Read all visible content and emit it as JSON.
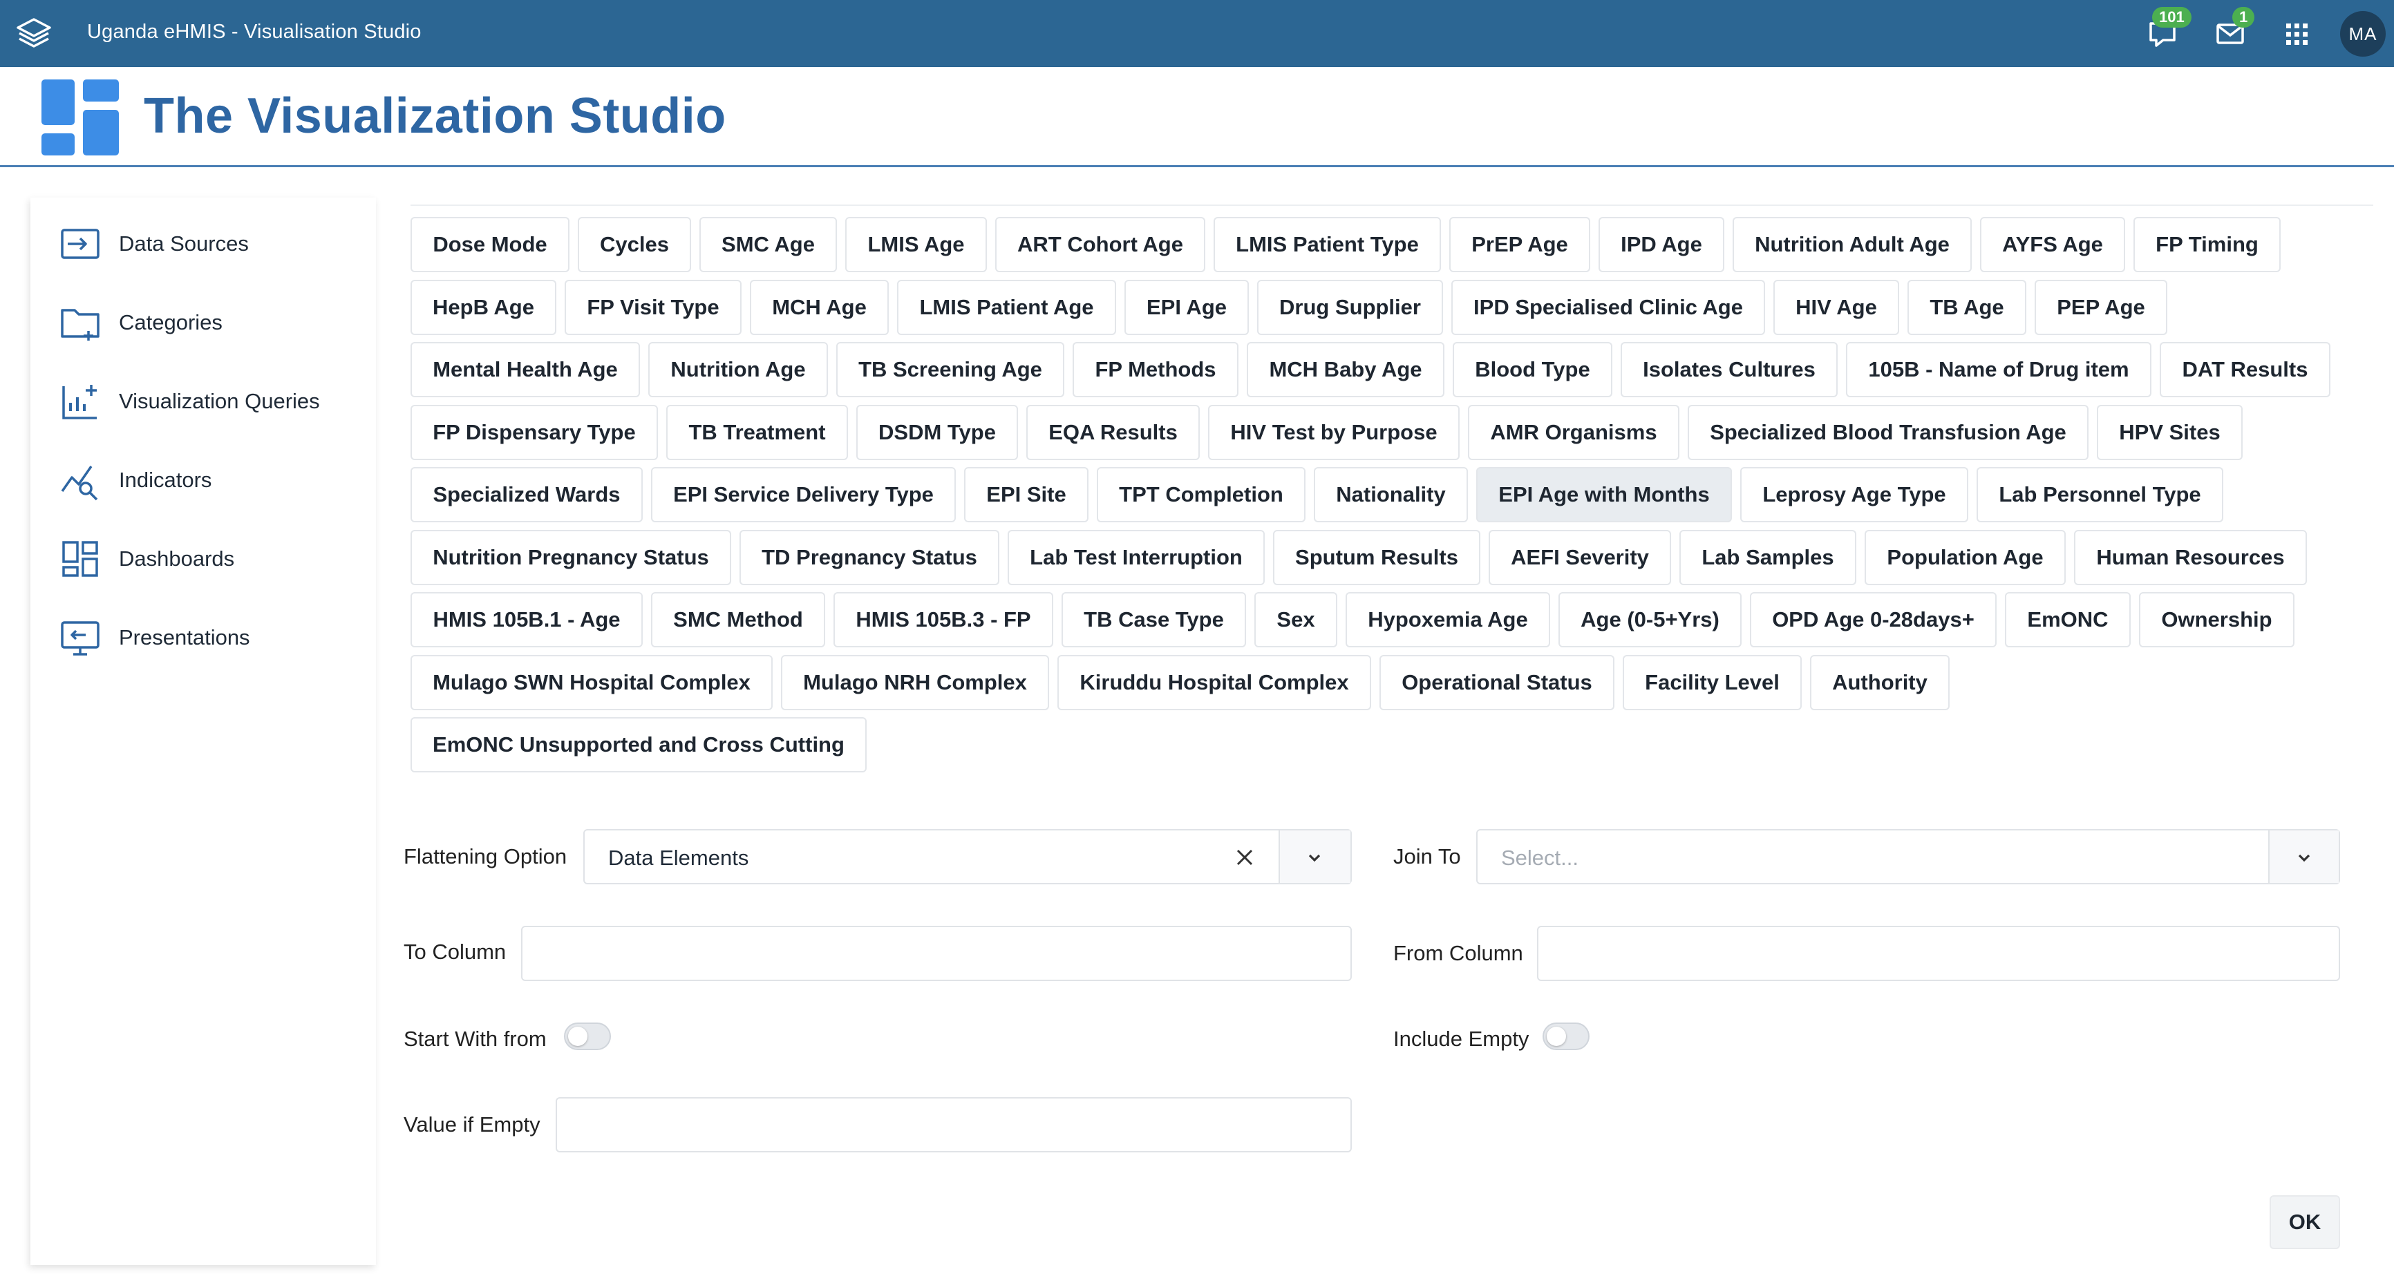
{
  "topbar": {
    "app_title": "Uganda eHMIS - Visualisation Studio",
    "interpretations_count": "101",
    "messages_count": "1",
    "avatar_initials": "MA",
    "color": "#2c6693"
  },
  "header": {
    "title": "The Visualization Studio",
    "title_color": "#2e66a3"
  },
  "sidebar": {
    "items": [
      {
        "label": "Data Sources",
        "icon": "data-source-icon"
      },
      {
        "label": "Categories",
        "icon": "folder-add-icon"
      },
      {
        "label": "Visualization Queries",
        "icon": "chart-add-icon"
      },
      {
        "label": "Indicators",
        "icon": "indicator-icon"
      },
      {
        "label": "Dashboards",
        "icon": "dashboard-icon"
      },
      {
        "label": "Presentations",
        "icon": "presentation-icon"
      }
    ]
  },
  "chips": {
    "selected": "EPI Age with Months",
    "rows": [
      [
        "Dose Mode",
        "Cycles",
        "SMC Age",
        "LMIS Age",
        "ART Cohort Age",
        "LMIS Patient Type",
        "PrEP Age",
        "IPD Age",
        "Nutrition Adult Age",
        "AYFS Age",
        "FP Timing"
      ],
      [
        "HepB Age",
        "FP Visit Type",
        "MCH Age",
        "LMIS Patient Age",
        "EPI Age",
        "Drug Supplier",
        "IPD Specialised Clinic Age",
        "HIV Age",
        "TB Age",
        "PEP Age"
      ],
      [
        "Mental Health Age",
        "Nutrition Age",
        "TB Screening Age",
        "FP Methods",
        "MCH Baby Age",
        "Blood Type",
        "Isolates Cultures",
        "105B - Name of Drug item",
        "DAT Results"
      ],
      [
        "FP Dispensary Type",
        "TB Treatment",
        "DSDM Type",
        "EQA Results",
        "HIV Test by Purpose",
        "AMR Organisms",
        "Specialized Blood Transfusion Age",
        "HPV Sites"
      ],
      [
        "Specialized Wards",
        "EPI Service Delivery Type",
        "EPI Site",
        "TPT Completion",
        "Nationality",
        "EPI Age with Months",
        "Leprosy Age Type",
        "Lab Personnel Type"
      ],
      [
        "Nutrition Pregnancy Status",
        "TD Pregnancy Status",
        "Lab Test Interruption",
        "Sputum Results",
        "AEFI Severity",
        "Lab Samples",
        "Population Age",
        "Human Resources"
      ],
      [
        "HMIS 105B.1 - Age",
        "SMC Method",
        "HMIS 105B.3 - FP",
        "TB Case Type",
        "Sex",
        "Hypoxemia Age",
        "Age (0-5+Yrs)",
        "OPD Age 0-28days+",
        "EmONC",
        "Ownership"
      ],
      [
        "Mulago SWN Hospital Complex",
        "Mulago NRH Complex",
        "Kiruddu Hospital Complex",
        "Operational Status",
        "Facility Level",
        "Authority"
      ],
      [
        "EmONC Unsupported and Cross Cutting"
      ]
    ]
  },
  "form": {
    "flattening_option_label": "Flattening Option",
    "flattening_option_value": "Data Elements",
    "join_to_label": "Join To",
    "join_to_placeholder": "Select...",
    "to_column_label": "To Column",
    "to_column_value": "",
    "from_column_label": "From Column",
    "from_column_value": "",
    "start_with_from_label": "Start With from",
    "start_with_from_on": false,
    "include_empty_label": "Include Empty",
    "include_empty_on": false,
    "value_if_empty_label": "Value if Empty",
    "value_if_empty_value": "",
    "ok_label": "OK"
  }
}
